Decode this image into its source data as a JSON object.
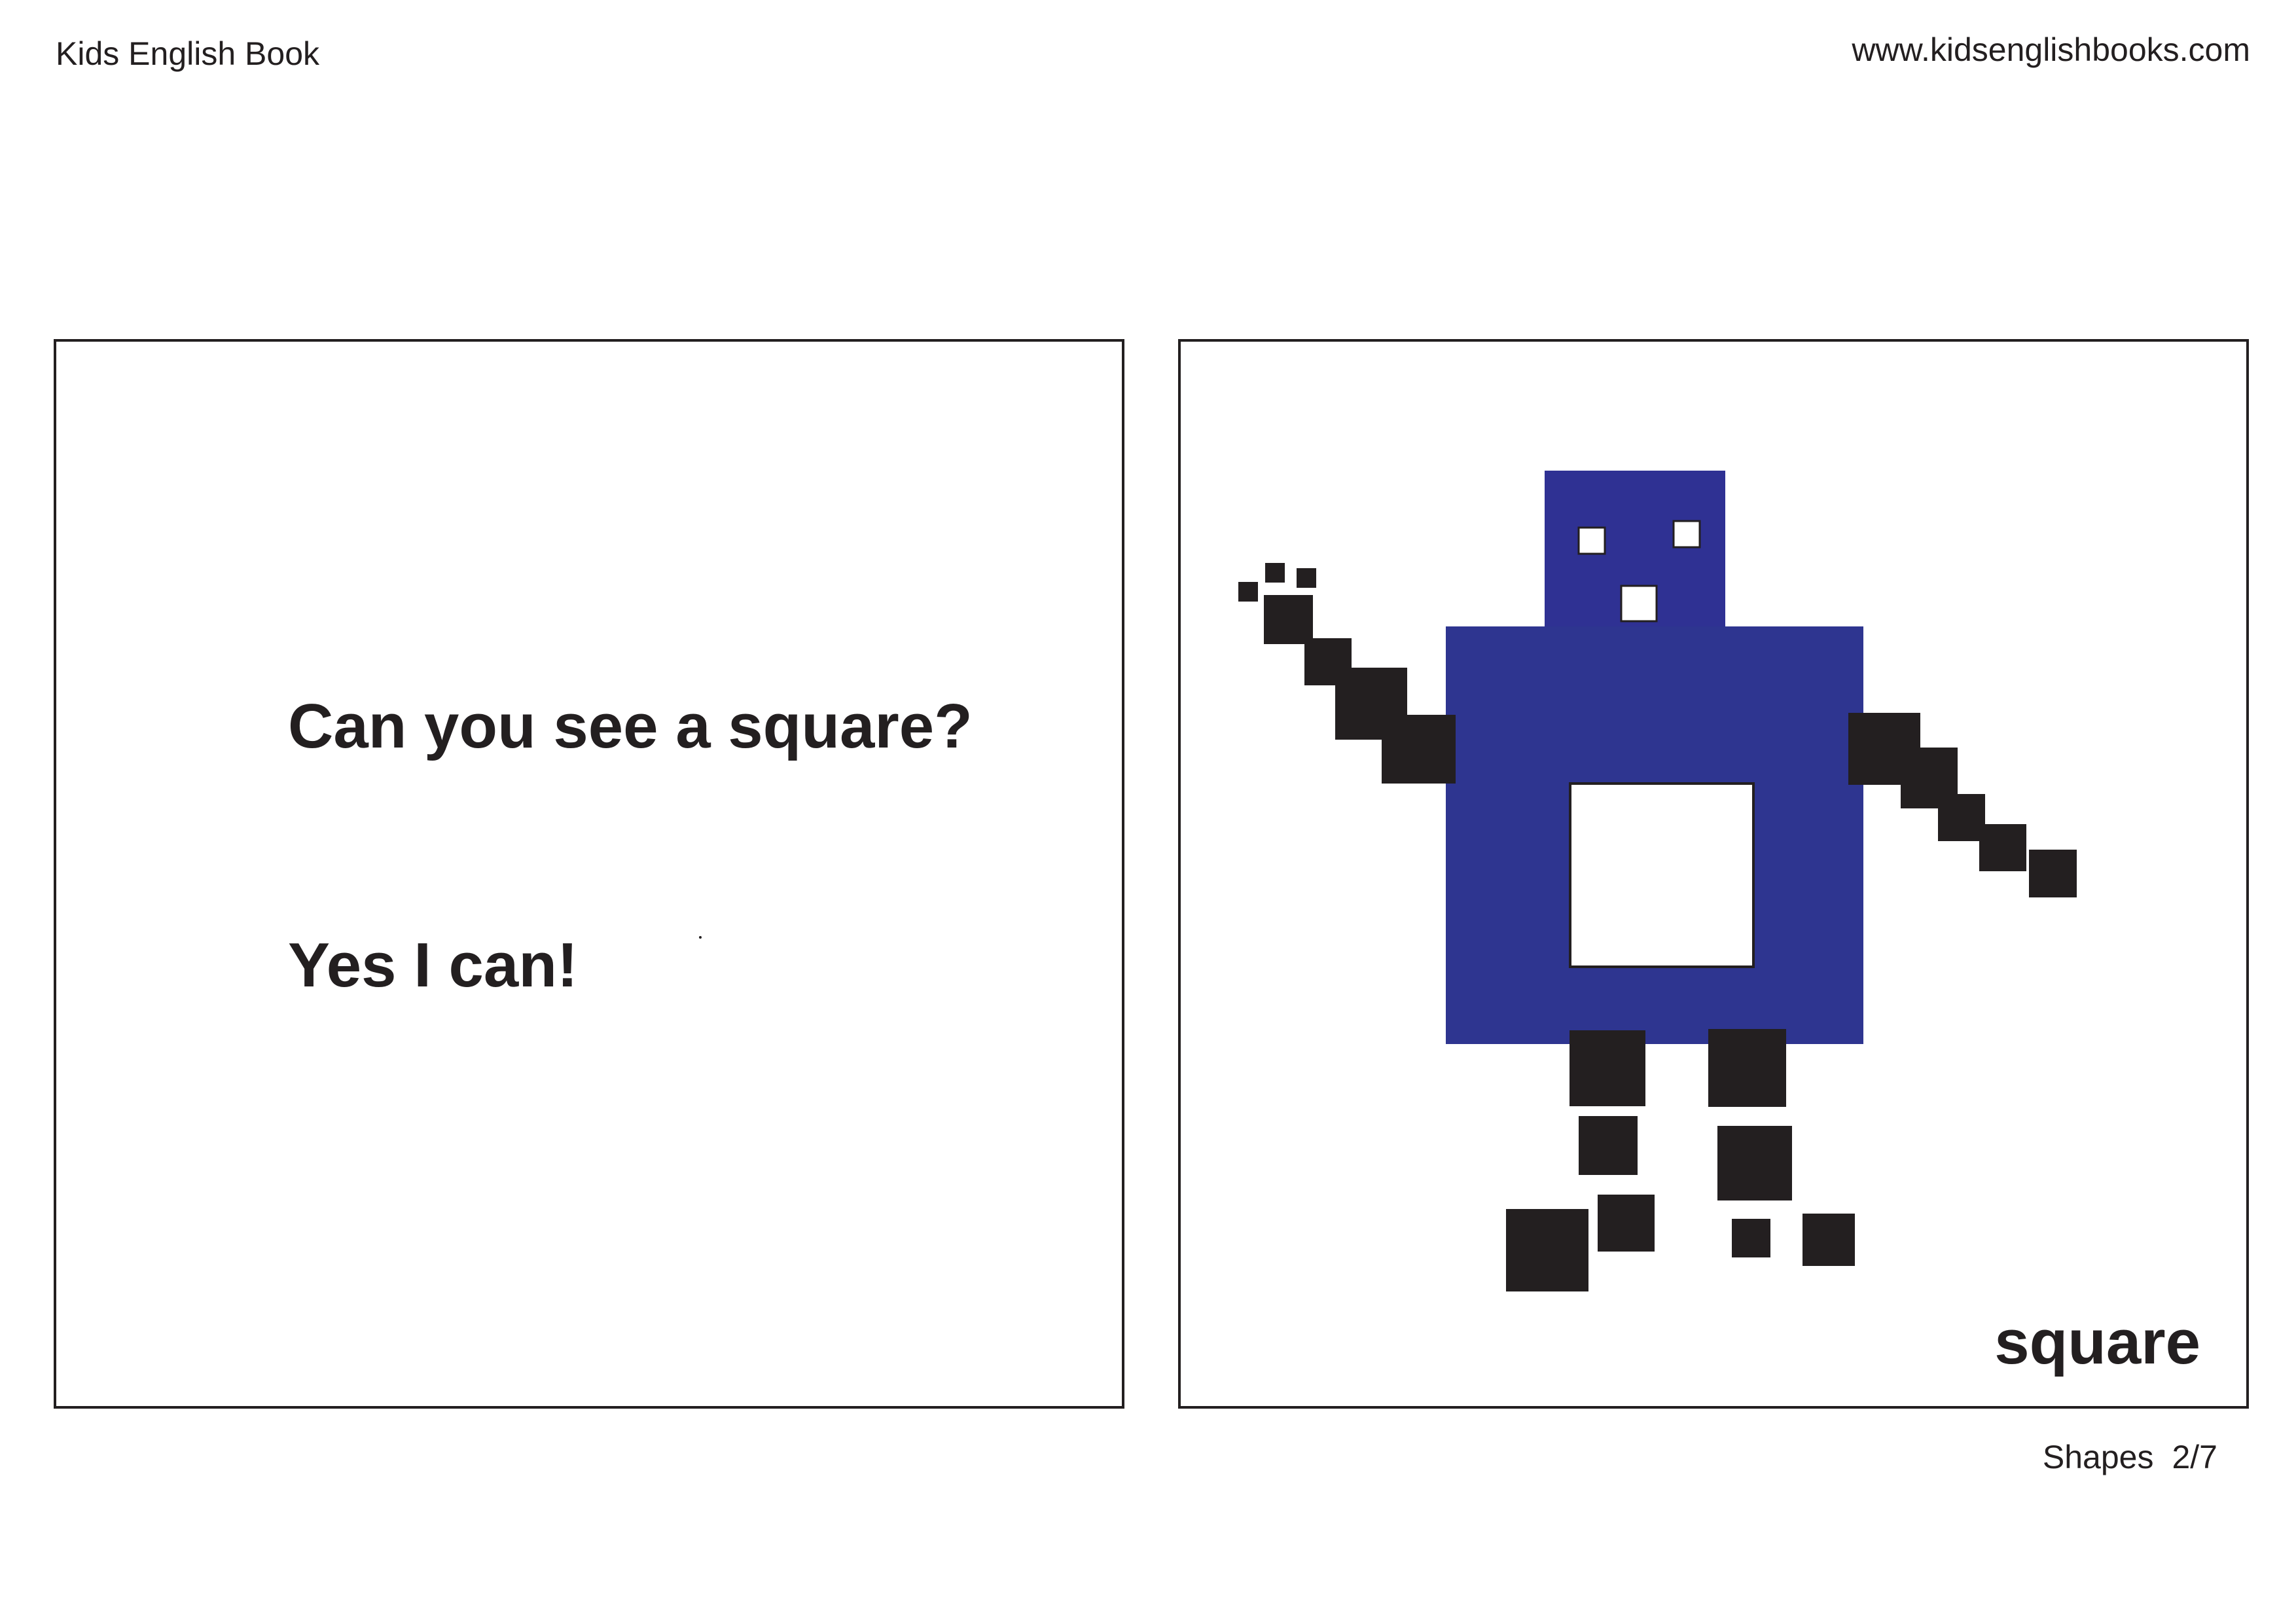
{
  "header": {
    "left_text": "Kids English Book",
    "right_text": "www.kidsenglishbooks.com"
  },
  "left_panel": {
    "question": "Can you see a square?",
    "answer": "Yes I can!"
  },
  "right_panel": {
    "word": "square",
    "illustration": "robot made of squares"
  },
  "footer": {
    "section": "Shapes",
    "page": "2/7"
  },
  "colors": {
    "ink": "#231f20",
    "robot_body": "#2e3590",
    "robot_head": "#2f3193",
    "panel_border": "#231f20"
  }
}
